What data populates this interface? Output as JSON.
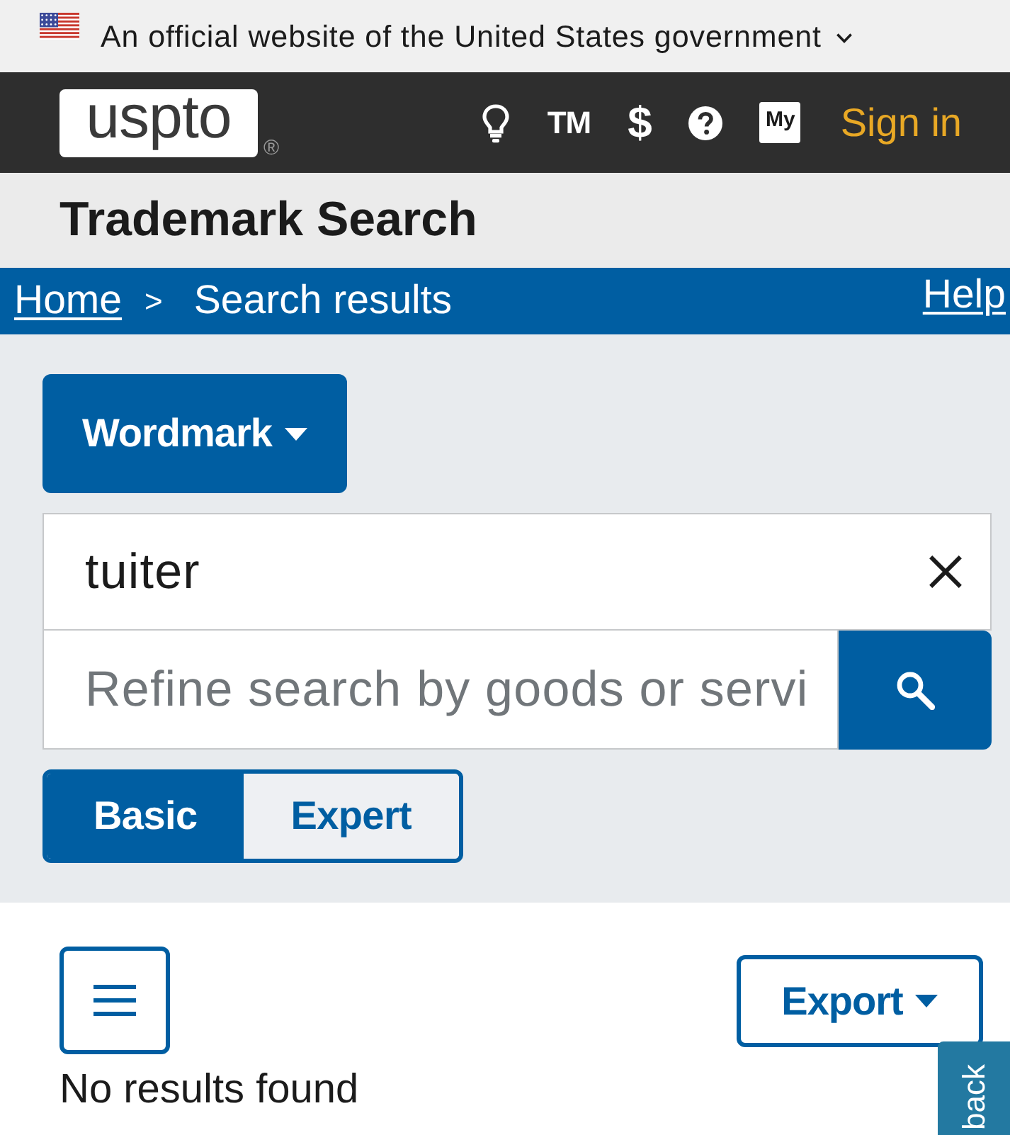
{
  "banner": {
    "text": "An official website of the United States government",
    "expanded": false
  },
  "header": {
    "logo": "uspto",
    "logo_mark": "®",
    "trademark": "TM",
    "fees": "$",
    "account": "My",
    "sign_in": "Sign in"
  },
  "title": "Trademark Search",
  "breadcrumb": {
    "home": "Home",
    "separator": ">",
    "current": "Search results",
    "help": "Help"
  },
  "search": {
    "type_dropdown": "Wordmark",
    "query": "tuiter",
    "refine_placeholder": "Refine search by goods or servi",
    "modes": [
      {
        "label": "Basic",
        "selected": true
      },
      {
        "label": "Expert",
        "selected": false
      }
    ]
  },
  "results": {
    "export": "Export",
    "message": "No results found"
  },
  "feedback_tab": "back"
}
